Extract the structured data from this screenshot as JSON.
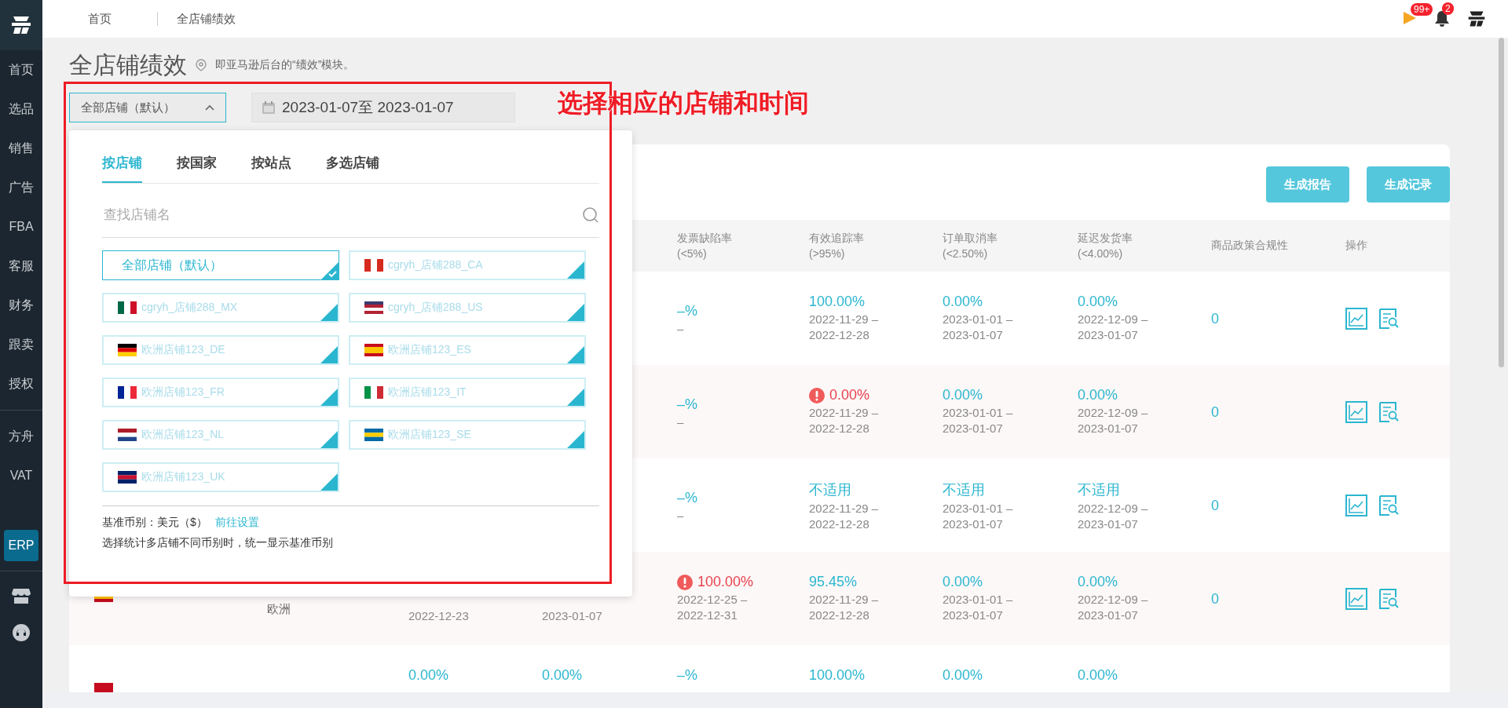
{
  "sidebar": {
    "items": [
      {
        "label": "首页",
        "kind": "text",
        "selected": false
      },
      {
        "label": "选品",
        "kind": "text",
        "selected": false
      },
      {
        "label": "销售",
        "kind": "text",
        "selected": false
      },
      {
        "label": "广告",
        "kind": "text",
        "selected": false
      },
      {
        "label": "FBA",
        "kind": "text",
        "selected": false
      },
      {
        "label": "客服",
        "kind": "text",
        "selected": false
      },
      {
        "label": "财务",
        "kind": "text",
        "selected": false
      },
      {
        "label": "跟卖",
        "kind": "text",
        "selected": false
      },
      {
        "label": "授权",
        "kind": "text",
        "selected": false
      },
      {
        "kind": "divider"
      },
      {
        "label": "方舟",
        "kind": "text",
        "selected": false
      },
      {
        "label": "VAT",
        "kind": "text",
        "selected": false
      },
      {
        "kind": "spacer"
      },
      {
        "label": "ERP",
        "kind": "text",
        "selected": true
      },
      {
        "kind": "divider"
      },
      {
        "kind": "store-icon"
      },
      {
        "kind": "support-icon"
      }
    ]
  },
  "breadcrumb": [
    "首页",
    "全店铺绩效"
  ],
  "header_right": {
    "flag_badge": "99+",
    "bell_badge": "2"
  },
  "page": {
    "title": "全店铺绩效",
    "subtitle": "即亚马逊后台的“绩效”模块。"
  },
  "filters": {
    "store_select": "全部店铺（默认）",
    "date_range": "2023-01-07至 2023-01-07"
  },
  "annotation": "选择相应的店铺和时间",
  "buttons": [
    "生成报告",
    "生成记录"
  ],
  "table": {
    "columns": [
      {},
      {},
      {},
      {},
      {
        "label": "发票缺陷率",
        "sub": "(<5%)"
      },
      {
        "label": "有效追踪率",
        "sub": "(>95%)"
      },
      {
        "label": "订单取消率",
        "sub": "(<2.50%)"
      },
      {
        "label": "延迟发货率",
        "sub": "(<4.00%)"
      },
      {
        "label": "商品政策合规性"
      },
      {
        "label": "操作"
      }
    ],
    "rows": [
      {
        "kind": "none",
        "cells": [
          {},
          {},
          {},
          {},
          {
            "value": "–%",
            "alert": false,
            "dates": [
              "–"
            ]
          },
          {
            "value": "100.00%",
            "alert": false,
            "dates": [
              "2022-11-29 –",
              "2022-12-28"
            ]
          },
          {
            "value": "0.00%",
            "alert": false,
            "dates": [
              "2023-01-01 –",
              "2023-01-07"
            ]
          },
          {
            "value": "0.00%",
            "alert": false,
            "dates": [
              "2022-12-09 –",
              "2023-01-07"
            ]
          },
          {
            "value": "0",
            "alert": false
          }
        ],
        "actions": true
      },
      {
        "kind": "none",
        "cells": [
          {},
          {},
          {},
          {},
          {
            "value": "–%",
            "alert": false,
            "dates": [
              "–"
            ]
          },
          {
            "value": "0.00%",
            "alert": true,
            "dates": [
              "2022-11-29 –",
              "2022-12-28"
            ]
          },
          {
            "value": "0.00%",
            "alert": false,
            "dates": [
              "2023-01-01 –",
              "2023-01-07"
            ]
          },
          {
            "value": "0.00%",
            "alert": false,
            "dates": [
              "2022-12-09 –",
              "2023-01-07"
            ]
          },
          {
            "value": "0",
            "alert": false
          }
        ],
        "actions": true
      },
      {
        "kind": "none",
        "cells": [
          {},
          {},
          {},
          {},
          {
            "value": "–%",
            "alert": false,
            "dates": [
              "–"
            ]
          },
          {
            "value": "不适用",
            "alert": false,
            "dates": [
              "2022-11-29 –",
              "2022-12-28"
            ]
          },
          {
            "value": "不适用",
            "alert": false,
            "dates": [
              "2023-01-01 –",
              "2023-01-07"
            ]
          },
          {
            "value": "不适用",
            "alert": false,
            "dates": [
              "2022-12-09 –",
              "2023-01-07"
            ]
          },
          {
            "value": "0",
            "alert": false
          }
        ],
        "actions": true
      },
      {
        "kind": "es",
        "cells": [
          {},
          {
            "text": "欧洲"
          },
          {
            "dates": [
              "2022-12-23"
            ]
          },
          {
            "dates": [
              "2023-01-07"
            ]
          },
          {
            "value": "100.00%",
            "alert": true,
            "dates": [
              "2022-12-25 –",
              "2022-12-31"
            ]
          },
          {
            "value": "95.45%",
            "alert": false,
            "dates": [
              "2022-11-29 –",
              "2022-12-28"
            ]
          },
          {
            "value": "0.00%",
            "alert": false,
            "dates": [
              "2023-01-01 –",
              "2023-01-07"
            ]
          },
          {
            "value": "0.00%",
            "alert": false,
            "dates": [
              "2022-12-09 –",
              "2023-01-07"
            ]
          },
          {
            "value": "0",
            "alert": false
          }
        ],
        "actions": true
      },
      {
        "kind": "red",
        "cells": [
          {},
          {},
          {
            "value": "0.00%",
            "alert": false
          },
          {
            "value": "0.00%",
            "alert": false
          },
          {
            "value": "–%",
            "alert": false
          },
          {
            "value": "100.00%",
            "alert": false
          },
          {
            "value": "0.00%",
            "alert": false
          },
          {
            "value": "0.00%",
            "alert": false
          },
          {}
        ]
      }
    ]
  },
  "dropdown": {
    "tabs": [
      {
        "label": "按店铺",
        "selected": true
      },
      {
        "label": "按国家",
        "selected": false
      },
      {
        "label": "按站点",
        "selected": false
      },
      {
        "label": "多选店铺",
        "selected": false
      }
    ],
    "search": {
      "placeholder": "查找店铺名"
    },
    "stores": [
      {
        "name": "全部店铺（默认）",
        "selected": true,
        "kind": "none"
      },
      {
        "name": "cgryh_店铺288_CA",
        "selected": false,
        "kind": "ca"
      },
      {
        "name": "cgryh_店铺288_MX",
        "selected": false,
        "kind": "mx"
      },
      {
        "name": "cgryh_店铺288_US",
        "selected": false,
        "kind": "us"
      },
      {
        "name": "欧洲店铺123_DE",
        "selected": false,
        "kind": "de"
      },
      {
        "name": "欧洲店铺123_ES",
        "selected": false,
        "kind": "es"
      },
      {
        "name": "欧洲店铺123_FR",
        "selected": false,
        "kind": "fr"
      },
      {
        "name": "欧洲店铺123_IT",
        "selected": false,
        "kind": "it"
      },
      {
        "name": "欧洲店铺123_NL",
        "selected": false,
        "kind": "nl"
      },
      {
        "name": "欧洲店铺123_SE",
        "selected": false,
        "kind": "se"
      },
      {
        "name": "欧洲店铺123_UK",
        "selected": false,
        "kind": "uk"
      }
    ],
    "currency": {
      "label": "基准币别：美元（$）",
      "link": "前往设置"
    },
    "note": "选择统计多店铺不同币别时，统一显示基准币别"
  }
}
